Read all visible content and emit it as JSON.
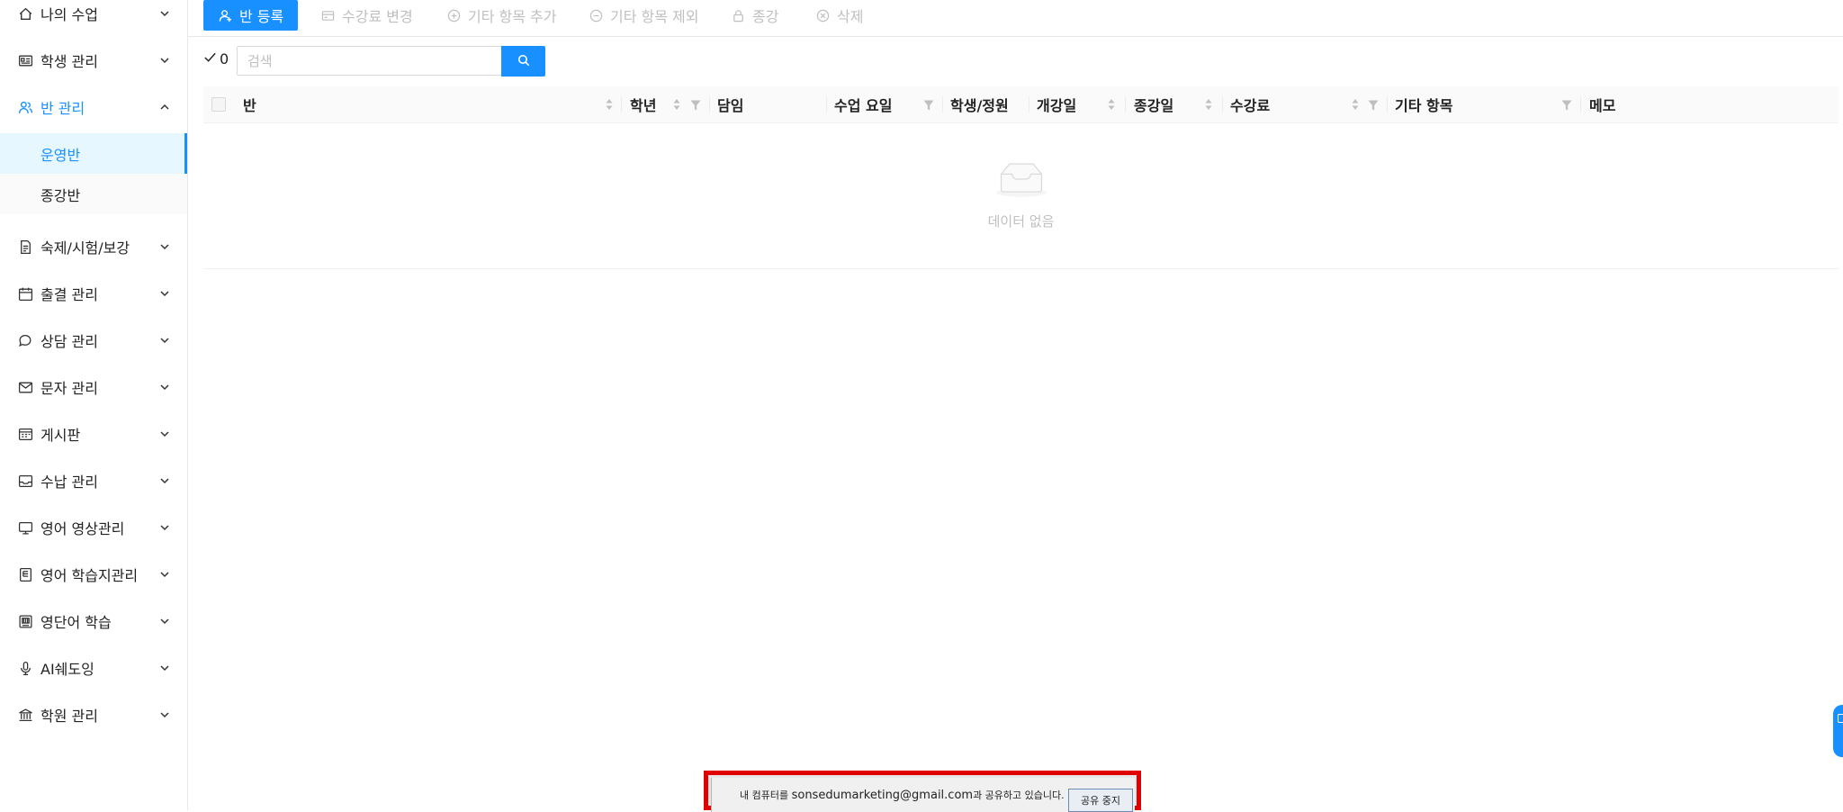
{
  "sidebar": {
    "items": [
      {
        "label": "나의 수업",
        "icon": "home-icon"
      },
      {
        "label": "학생 관리",
        "icon": "id-card-icon"
      },
      {
        "label": "반 관리",
        "icon": "team-icon"
      },
      {
        "label": "숙제/시험/보강",
        "icon": "file-icon"
      },
      {
        "label": "출결 관리",
        "icon": "calendar-icon"
      },
      {
        "label": "상담 관리",
        "icon": "chat-icon"
      },
      {
        "label": "문자 관리",
        "icon": "mail-icon"
      },
      {
        "label": "게시판",
        "icon": "board-icon"
      },
      {
        "label": "수납 관리",
        "icon": "inbox-icon"
      },
      {
        "label": "영어 영상관리",
        "icon": "monitor-icon"
      },
      {
        "label": "영어 학습지관리",
        "icon": "document-icon"
      },
      {
        "label": "영단어 학습",
        "icon": "wordbook-icon"
      },
      {
        "label": "AI쉐도잉",
        "icon": "microphone-icon"
      },
      {
        "label": "학원 관리",
        "icon": "bank-icon"
      }
    ],
    "submenu": [
      {
        "label": "운영반",
        "selected": true
      },
      {
        "label": "종강반",
        "selected": false
      }
    ]
  },
  "toolbar": {
    "register": "반 등록",
    "change_fee": "수강료 변경",
    "add_item": "기타 항목 추가",
    "remove_item": "기타 항목 제외",
    "close_class": "종강",
    "delete": "삭제"
  },
  "filter": {
    "count": "0",
    "search_placeholder": "검색"
  },
  "table": {
    "columns": [
      "반",
      "학년",
      "담임",
      "수업 요일",
      "학생/정원",
      "개강일",
      "종강일",
      "수강료",
      "기타 항목",
      "메모"
    ],
    "rows": [],
    "empty_text": "데이터 없음"
  },
  "share_bar": {
    "prefix": "내 컴퓨터를 ",
    "email": "sonsedumarketing@gmail.com",
    "suffix": "과 공유하고 있습니다.",
    "stop_label": "공유 중지"
  },
  "colors": {
    "accent": "#1890ff",
    "highlight_border": "#e00000"
  }
}
